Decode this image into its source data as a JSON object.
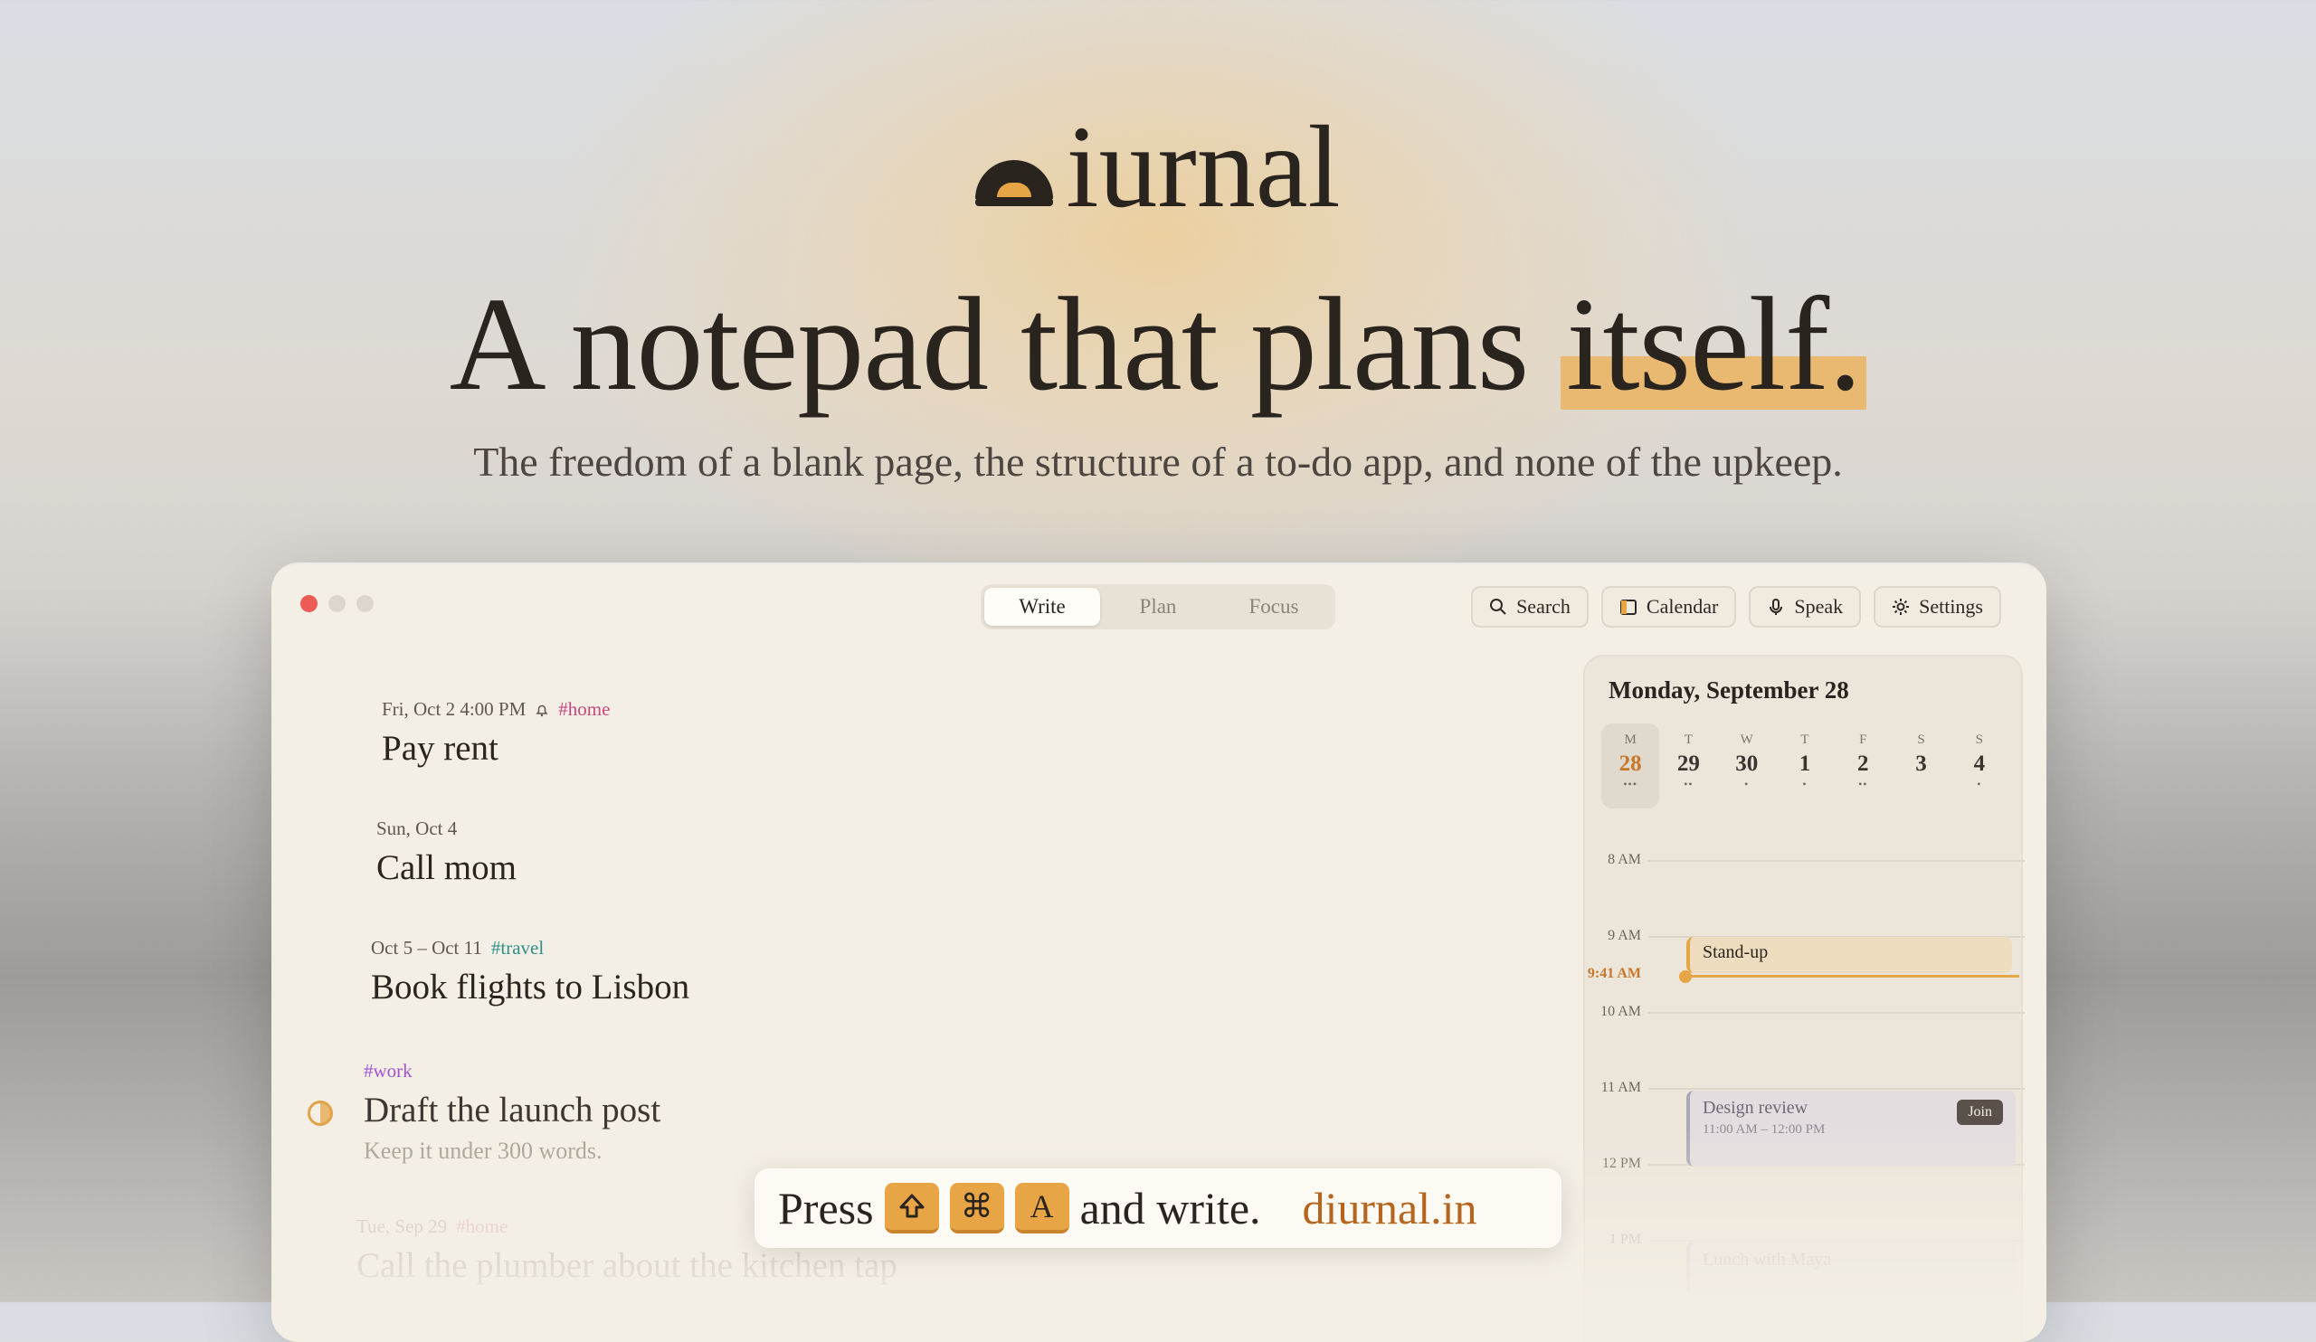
{
  "brand": {
    "word": "iurnal"
  },
  "hero": {
    "headline_main": "A notepad that plans ",
    "headline_highlight": "itself.",
    "subline": "The freedom of a blank page, the structure of a to-do app, and none of the upkeep."
  },
  "window": {
    "tabs": [
      {
        "label": "Write",
        "active": true
      },
      {
        "label": "Plan",
        "active": false
      },
      {
        "label": "Focus",
        "active": false
      }
    ],
    "toolbar": {
      "search": {
        "label": "Search",
        "icon": "search-icon"
      },
      "calendar": {
        "label": "Calendar",
        "icon": "calendar-icon"
      },
      "speak": {
        "label": "Speak",
        "icon": "microphone-icon"
      },
      "settings": {
        "label": "Settings",
        "icon": "gear-icon"
      }
    }
  },
  "notes": [
    {
      "date": "Fri, Oct 2  4:00 PM",
      "tag": "#home",
      "title": "Pay rent",
      "icon": "bell-icon"
    },
    {
      "date": "Sun, Oct 4",
      "tag": "",
      "title": "Call mom"
    },
    {
      "date": "Oct 5 – Oct 11",
      "tag": "#travel",
      "title": "Book flights to Lisbon"
    },
    {
      "date": "",
      "tag": "#work",
      "title": "Draft the launch post",
      "subtitle": "Keep it under 300 words.",
      "progress": 0.5
    },
    {
      "date": "Tue, Sep 29",
      "tag": "#home",
      "title": "Call the plumber about the kitchen tap"
    }
  ],
  "calendar": {
    "title": "Monday, September 28",
    "days": [
      {
        "letter": "M",
        "num": "28",
        "dots": "•••",
        "selected": true
      },
      {
        "letter": "T",
        "num": "29",
        "dots": "••"
      },
      {
        "letter": "W",
        "num": "30",
        "dots": "•"
      },
      {
        "letter": "T",
        "num": "1",
        "dots": "•"
      },
      {
        "letter": "F",
        "num": "2",
        "dots": "••"
      },
      {
        "letter": "S",
        "num": "3",
        "dots": ""
      },
      {
        "letter": "S",
        "num": "4",
        "dots": "•"
      }
    ],
    "hours": [
      "8 AM",
      "9 AM",
      "10 AM",
      "11 AM",
      "12 PM",
      "1 PM"
    ],
    "now": "9:41 AM",
    "events": [
      {
        "title": "Stand-up"
      },
      {
        "title": "Design review",
        "time": "11:00 AM – 12:00 PM",
        "action": "Join"
      },
      {
        "title": "Lunch with Maya"
      }
    ]
  },
  "cta": {
    "press": "Press",
    "keys": [
      "shift-key-icon",
      "command-key-icon",
      "A"
    ],
    "after": "and write.",
    "domain": "diurnal.in"
  },
  "colors": {
    "accent": "#e7a646",
    "highlight": "#e9b871",
    "background": "#f4efe4",
    "brand_dark": "#2a241f"
  }
}
